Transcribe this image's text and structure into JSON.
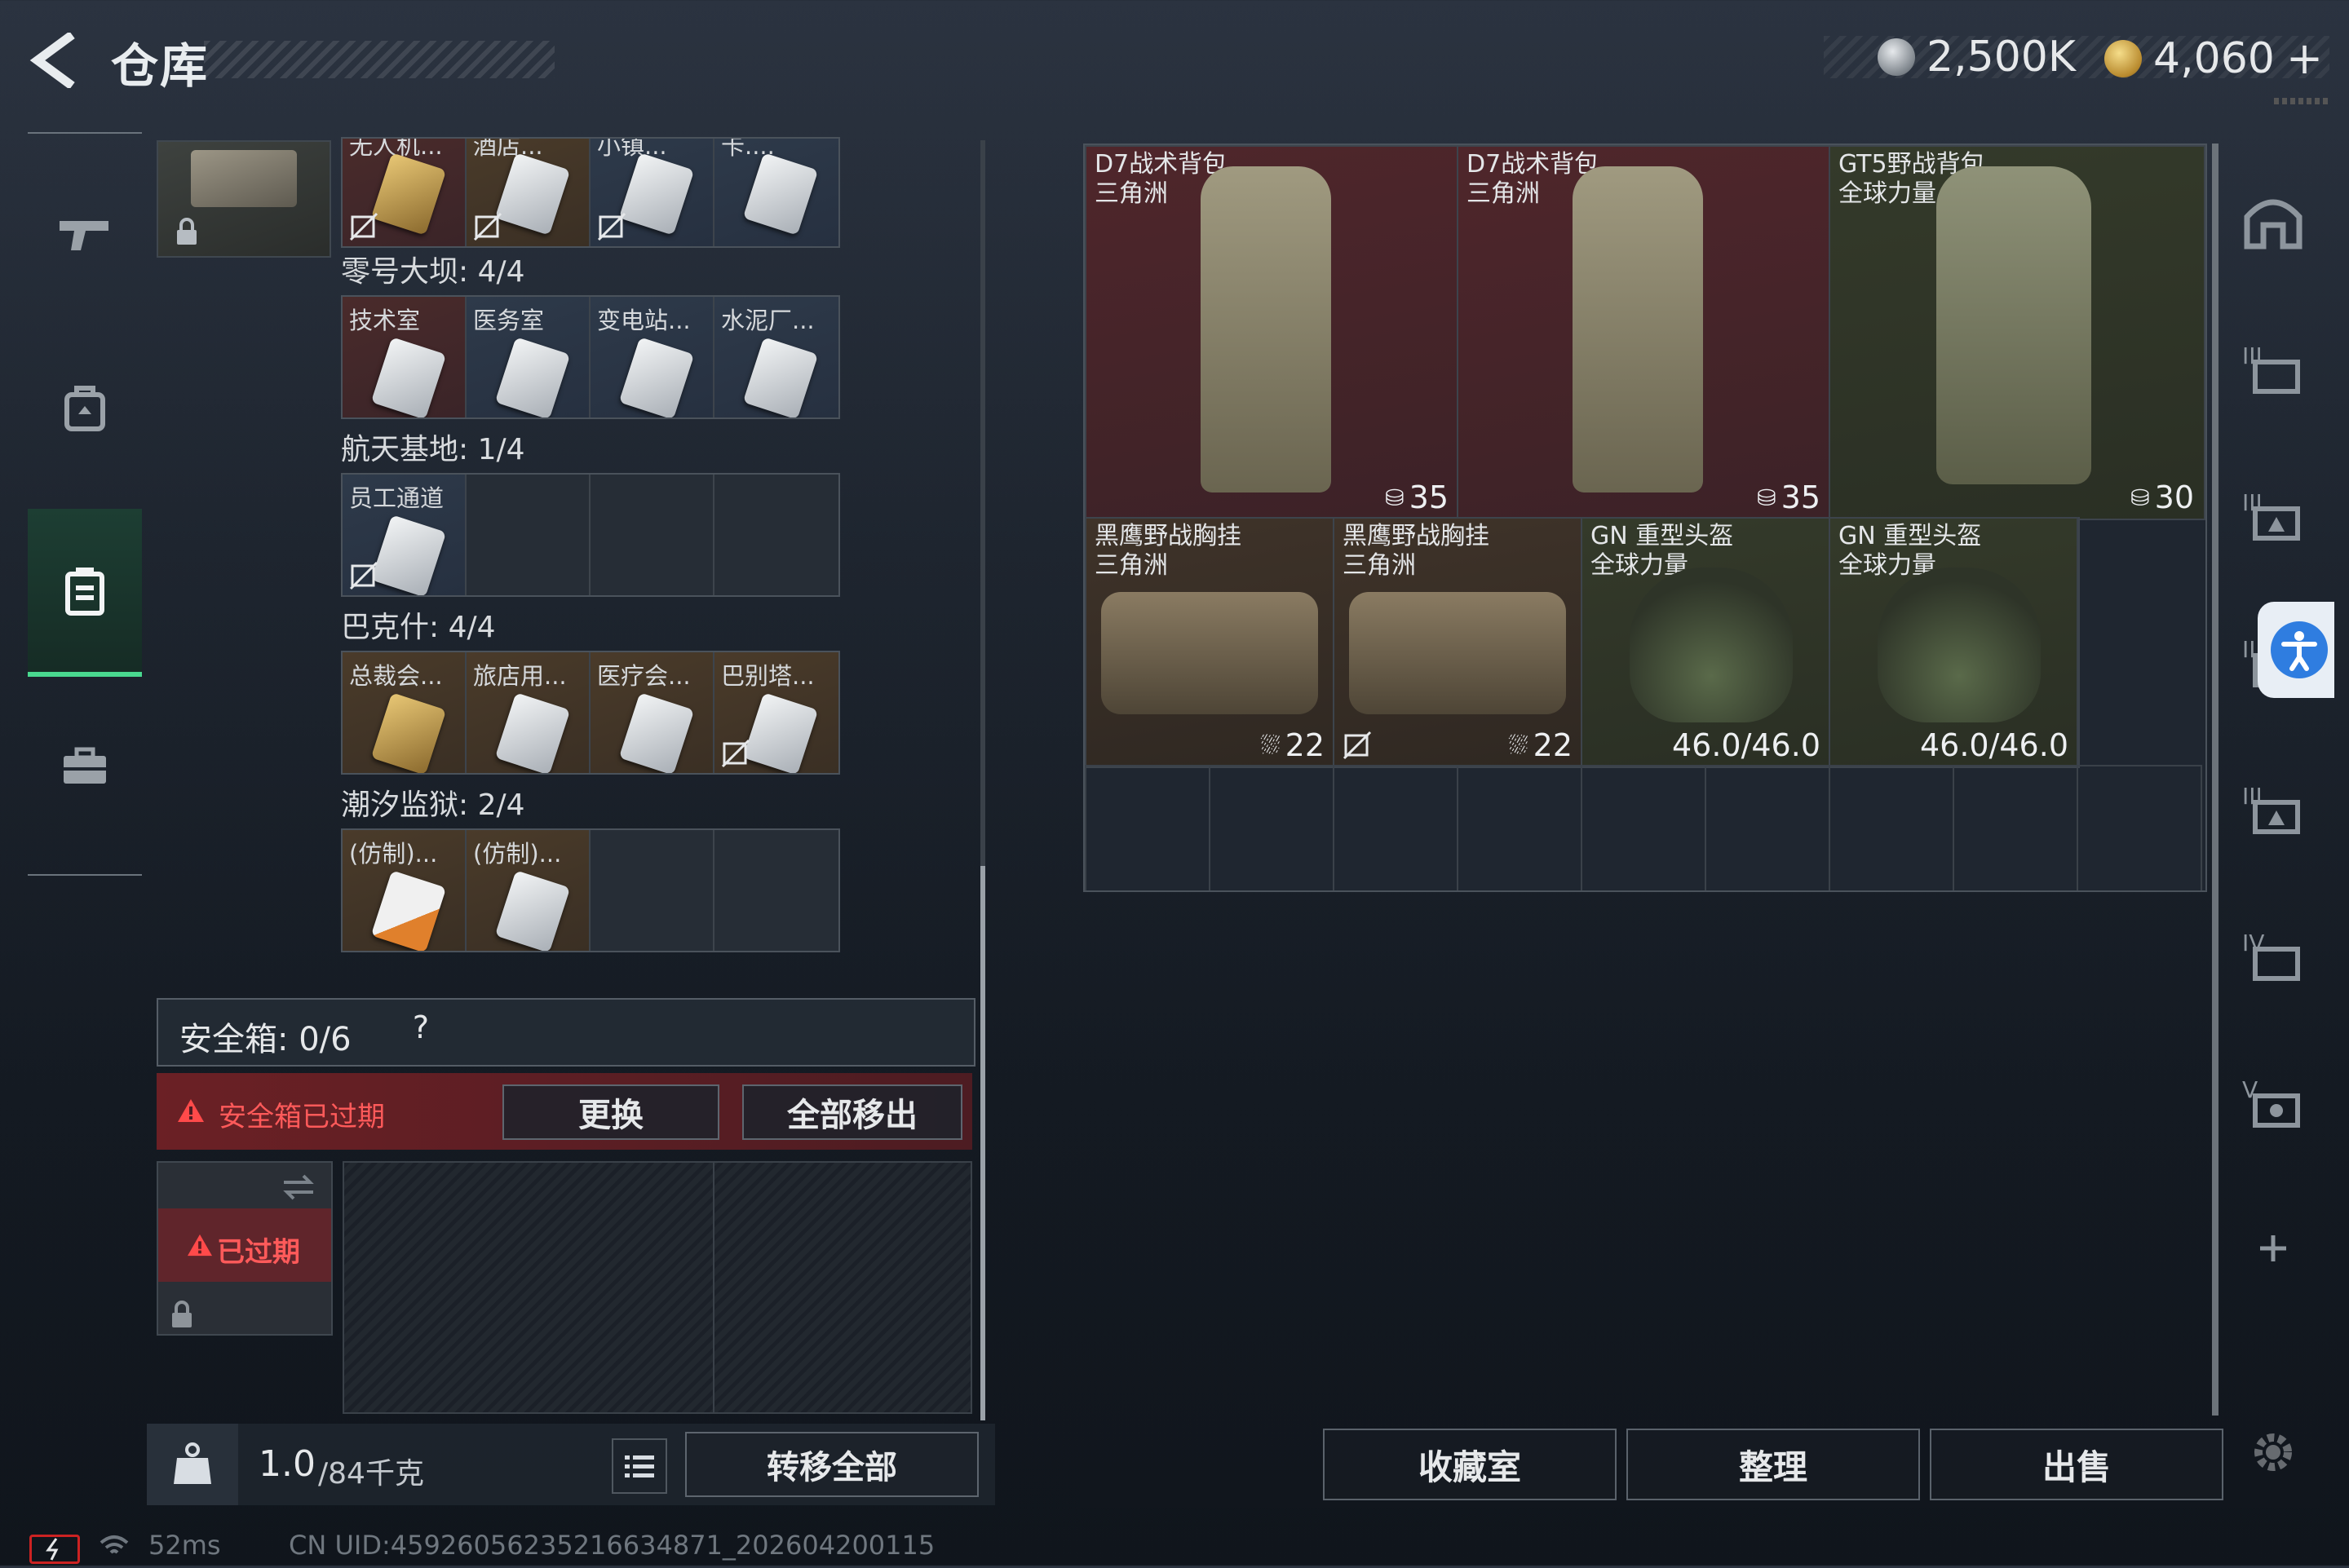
{
  "header": {
    "title": "仓库",
    "currency1": "2,500K",
    "currency2": "4,060",
    "currency2_add": "+"
  },
  "left_nav": {
    "items": [
      "weapon-icon",
      "armor-icon",
      "backpack-icon",
      "case-icon"
    ],
    "active_index": 2
  },
  "stash": {
    "top_row": {
      "labels": [
        "无人机...",
        "酒店...",
        "小镇...",
        "卡...."
      ]
    },
    "groups": [
      {
        "title": "零号大坝: 4/4",
        "cells": [
          {
            "label": "技术室",
            "tone": "red"
          },
          {
            "label": "医务室",
            "tone": "blue"
          },
          {
            "label": "变电站...",
            "tone": "blue"
          },
          {
            "label": "水泥厂...",
            "tone": "blue"
          }
        ]
      },
      {
        "title": "航天基地: 1/4",
        "cells": [
          {
            "label": "员工通道",
            "tone": "blue"
          },
          {
            "label": "",
            "tone": "empty"
          },
          {
            "label": "",
            "tone": "empty"
          },
          {
            "label": "",
            "tone": "empty"
          }
        ]
      },
      {
        "title": "巴克什: 4/4",
        "cells": [
          {
            "label": "总裁会...",
            "tone": "gold"
          },
          {
            "label": "旅店用...",
            "tone": "gold"
          },
          {
            "label": "医疗会...",
            "tone": "gold"
          },
          {
            "label": "巴别塔...",
            "tone": "gold"
          }
        ]
      },
      {
        "title": "潮汐监狱: 2/4",
        "cells": [
          {
            "label": "(仿制)...",
            "tone": "gold"
          },
          {
            "label": "(仿制)...",
            "tone": "gold"
          },
          {
            "label": "",
            "tone": "empty"
          },
          {
            "label": "",
            "tone": "empty"
          }
        ]
      }
    ]
  },
  "safe_box": {
    "title": "安全箱: 0/6",
    "help": "?",
    "expired_warning": "安全箱已过期",
    "replace_label": "更换",
    "remove_all_label": "全部移出",
    "expired_badge": "已过期"
  },
  "weight": {
    "current": "1.0",
    "max": "/84千克",
    "kg_label": "KG"
  },
  "transfer_all_label": "转移全部",
  "storage": {
    "items": [
      {
        "name": "D7战术背包",
        "origin": "三角洲",
        "value": "35",
        "type": "backpack"
      },
      {
        "name": "D7战术背包",
        "origin": "三角洲",
        "value": "35",
        "type": "backpack"
      },
      {
        "name": "GT5野战背包",
        "origin": "全球力量",
        "value": "30",
        "type": "backpack"
      },
      {
        "name": "黑鹰野战胸挂",
        "origin": "三角洲",
        "value": "22",
        "type": "rig"
      },
      {
        "name": "黑鹰野战胸挂",
        "origin": "三角洲",
        "value": "22",
        "type": "rig"
      },
      {
        "name": "GN 重型头盔",
        "origin": "全球力量",
        "value": "46.0/46.0",
        "type": "helmet"
      },
      {
        "name": "GN 重型头盔",
        "origin": "全球力量",
        "value": "46.0/46.0",
        "type": "helmet"
      }
    ]
  },
  "right_nav": {
    "items": [
      "home-icon",
      "storage-3-icon",
      "storage-3b-icon",
      "storage-3c-icon",
      "storage-3d-icon",
      "storage-4-icon",
      "storage-5-icon",
      "add-icon"
    ]
  },
  "bottom_buttons": {
    "collection": "收藏室",
    "organize": "整理",
    "sell": "出售"
  },
  "status": {
    "ping": "52ms",
    "uid": "CN UID:4592605623521663487​1_202604200115"
  },
  "colors": {
    "accent_green": "#49d98f",
    "warning_red": "#ff4a4a",
    "item_red": "#4f262b"
  }
}
